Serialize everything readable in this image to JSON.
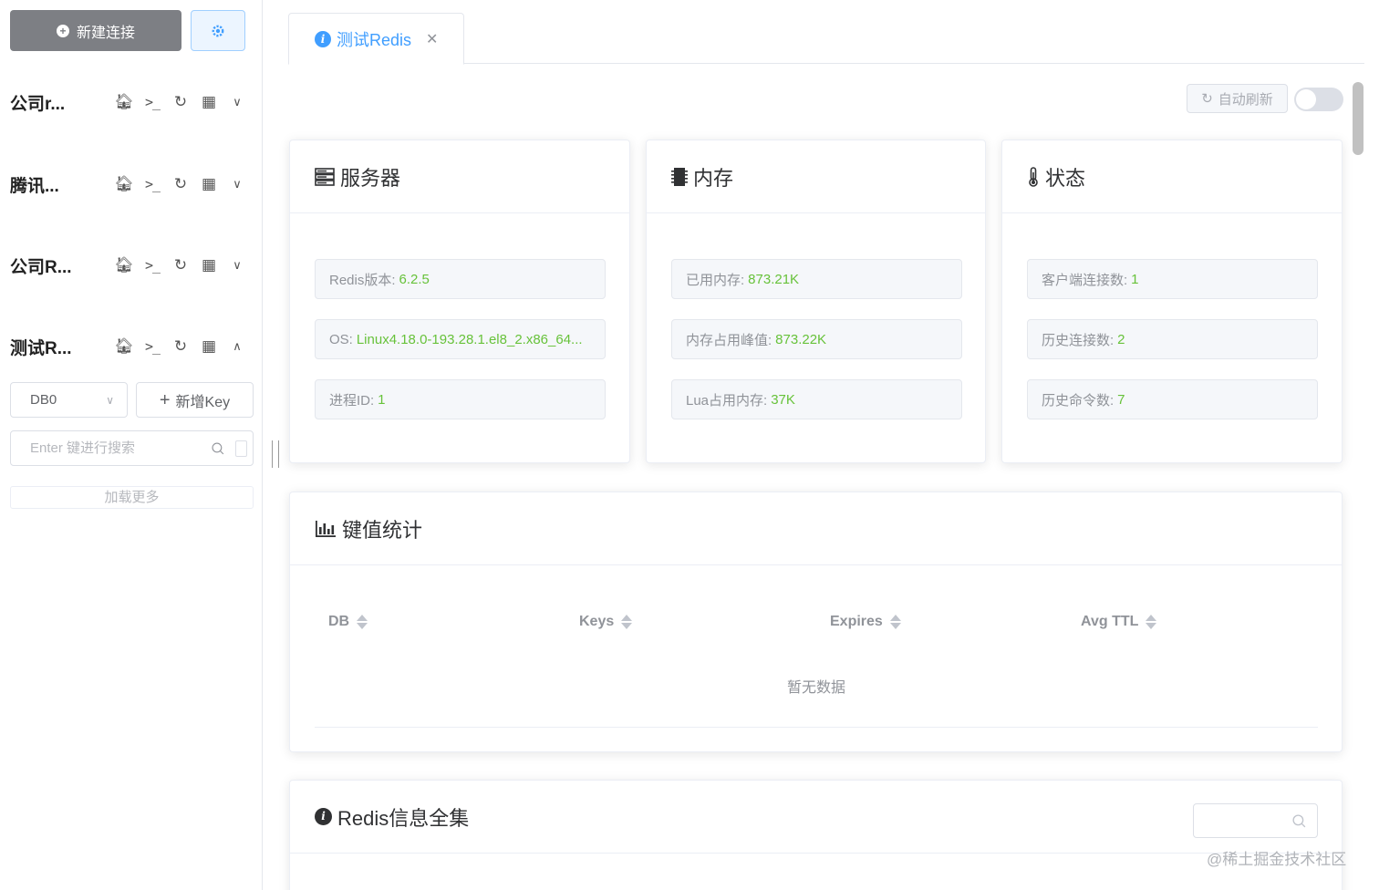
{
  "sidebar": {
    "new_connection_label": "新建连接",
    "connections": [
      {
        "name": "公司r...",
        "expanded": false
      },
      {
        "name": "腾讯...",
        "expanded": false
      },
      {
        "name": "公司R...",
        "expanded": false
      },
      {
        "name": "测试R...",
        "expanded": true
      }
    ],
    "db_select": {
      "value": "DB0"
    },
    "new_key_label": "新增Key",
    "search": {
      "placeholder": "Enter 键进行搜索"
    },
    "load_more_label": "加载更多"
  },
  "tabs": [
    {
      "label": "测试Redis",
      "active": true
    }
  ],
  "toolbar": {
    "auto_refresh_label": "自动刷新",
    "auto_refresh_enabled": false
  },
  "server_card": {
    "title": "服务器",
    "fields": [
      {
        "label": "Redis版本:",
        "value": "6.2.5"
      },
      {
        "label": "OS:",
        "value": "Linux4.18.0-193.28.1.el8_2.x86_64..."
      },
      {
        "label": "进程ID:",
        "value": "1"
      }
    ]
  },
  "memory_card": {
    "title": "内存",
    "fields": [
      {
        "label": "已用内存:",
        "value": "873.21K"
      },
      {
        "label": "内存占用峰值:",
        "value": "873.22K"
      },
      {
        "label": "Lua占用内存:",
        "value": "37K"
      }
    ]
  },
  "status_card": {
    "title": "状态",
    "fields": [
      {
        "label": "客户端连接数:",
        "value": "1"
      },
      {
        "label": "历史连接数:",
        "value": "2"
      },
      {
        "label": "历史命令数:",
        "value": "7"
      }
    ]
  },
  "key_stats": {
    "title": "键值统计",
    "columns": [
      "DB",
      "Keys",
      "Expires",
      "Avg TTL"
    ],
    "empty_text": "暂无数据"
  },
  "redis_info": {
    "title": "Redis信息全集"
  },
  "watermark": "@稀土掘金技术社区",
  "colors": {
    "primary": "#409eff",
    "success": "#67c23a",
    "sidebar_button": "#7d7f84"
  }
}
